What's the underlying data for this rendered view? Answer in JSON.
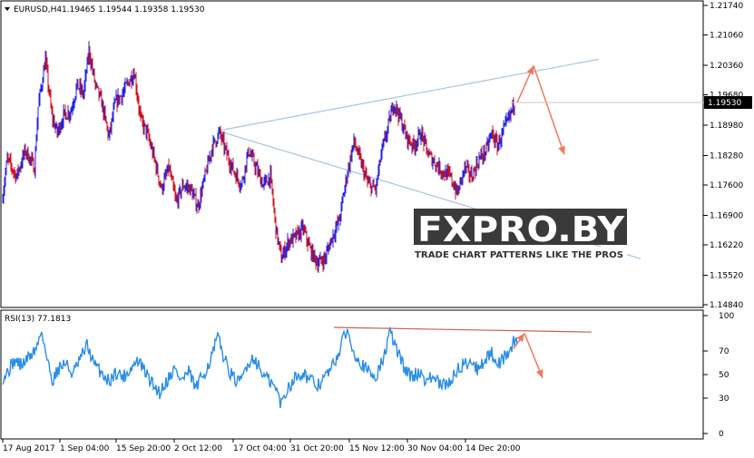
{
  "header": {
    "symbol": "EURUSD,H4",
    "ohlc": "1.19465 1.19544 1.19358 1.19530"
  },
  "current_price_label": "1.19530",
  "rsi_header": "RSI(13) 77.1813",
  "watermark": {
    "brand": "FXPRO.BY",
    "tagline": "TRADE CHART PATTERNS LIKE THE PROS"
  },
  "colors": {
    "bull": "#1e23e6",
    "bear": "#d0101e",
    "rsi": "#2a8ee6",
    "trendline": "#a8c4dc",
    "arrow": "#f07860",
    "rsi_resistance": "#c86050"
  },
  "chart_data": [
    {
      "type": "candlestick",
      "title": "EURUSD,H4",
      "y_ticks": [
        "1.21740",
        "1.21060",
        "1.20360",
        "1.19680",
        "1.18980",
        "1.18280",
        "1.17600",
        "1.16900",
        "1.16220",
        "1.15520",
        "1.14840"
      ],
      "ylim": [
        1.1484,
        1.2174
      ],
      "x_ticks": [
        "17 Aug 2017",
        "1 Sep 04:00",
        "15 Sep 20:00",
        "2 Oct 12:00",
        "17 Oct 04:00",
        "31 Oct 20:00",
        "15 Nov 12:00",
        "30 Nov 04:00",
        "14 Dec 20:00"
      ],
      "last_close": 1.1953,
      "path": [
        [
          0,
          1.169
        ],
        [
          8,
          1.182
        ],
        [
          18,
          1.178
        ],
        [
          28,
          1.184
        ],
        [
          38,
          1.18
        ],
        [
          42,
          1.194
        ],
        [
          50,
          1.205
        ],
        [
          57,
          1.192
        ],
        [
          63,
          1.188
        ],
        [
          70,
          1.192
        ],
        [
          78,
          1.193
        ],
        [
          85,
          1.199
        ],
        [
          92,
          1.197
        ],
        [
          98,
          1.207
        ],
        [
          105,
          1.199
        ],
        [
          112,
          1.195
        ],
        [
          120,
          1.187
        ],
        [
          127,
          1.195
        ],
        [
          135,
          1.197
        ],
        [
          142,
          1.2
        ],
        [
          148,
          1.202
        ],
        [
          155,
          1.191
        ],
        [
          162,
          1.188
        ],
        [
          170,
          1.182
        ],
        [
          178,
          1.175
        ],
        [
          186,
          1.18
        ],
        [
          194,
          1.172
        ],
        [
          202,
          1.176
        ],
        [
          210,
          1.175
        ],
        [
          218,
          1.171
        ],
        [
          226,
          1.178
        ],
        [
          234,
          1.185
        ],
        [
          242,
          1.188
        ],
        [
          250,
          1.183
        ],
        [
          258,
          1.179
        ],
        [
          266,
          1.176
        ],
        [
          274,
          1.184
        ],
        [
          282,
          1.18
        ],
        [
          290,
          1.176
        ],
        [
          298,
          1.178
        ],
        [
          304,
          1.166
        ],
        [
          310,
          1.159
        ],
        [
          318,
          1.163
        ],
        [
          326,
          1.164
        ],
        [
          334,
          1.166
        ],
        [
          342,
          1.161
        ],
        [
          350,
          1.158
        ],
        [
          358,
          1.159
        ],
        [
          366,
          1.164
        ],
        [
          374,
          1.168
        ],
        [
          382,
          1.178
        ],
        [
          390,
          1.186
        ],
        [
          398,
          1.181
        ],
        [
          406,
          1.176
        ],
        [
          414,
          1.175
        ],
        [
          420,
          1.183
        ],
        [
          426,
          1.188
        ],
        [
          434,
          1.195
        ],
        [
          440,
          1.192
        ],
        [
          448,
          1.187
        ],
        [
          456,
          1.185
        ],
        [
          464,
          1.188
        ],
        [
          472,
          1.183
        ],
        [
          480,
          1.181
        ],
        [
          488,
          1.179
        ],
        [
          496,
          1.178
        ],
        [
          504,
          1.174
        ],
        [
          512,
          1.18
        ],
        [
          520,
          1.178
        ],
        [
          528,
          1.182
        ],
        [
          536,
          1.184
        ],
        [
          542,
          1.188
        ],
        [
          548,
          1.185
        ],
        [
          556,
          1.189
        ],
        [
          562,
          1.192
        ],
        [
          567,
          1.1953
        ]
      ],
      "trendlines": [
        {
          "x1": 240,
          "y1": 1.1885,
          "x2": 660,
          "y2": 1.205
        },
        {
          "x1": 240,
          "y1": 1.1885,
          "x2": 706,
          "y2": 1.159
        }
      ],
      "arrows": [
        {
          "x1": 570,
          "y1": 1.195,
          "x2": 588,
          "y2": 1.2035
        },
        {
          "x1": 588,
          "y1": 1.2035,
          "x2": 622,
          "y2": 1.183
        }
      ]
    },
    {
      "type": "line",
      "title": "RSI(13) 77.1813",
      "y_ticks": [
        "100",
        "70",
        "50",
        "30",
        "0"
      ],
      "ylim": [
        0,
        100
      ],
      "last_value": 77.1813,
      "path": [
        [
          0,
          45
        ],
        [
          8,
          52
        ],
        [
          16,
          62
        ],
        [
          24,
          58
        ],
        [
          32,
          65
        ],
        [
          40,
          72
        ],
        [
          46,
          88
        ],
        [
          52,
          62
        ],
        [
          58,
          45
        ],
        [
          64,
          55
        ],
        [
          72,
          60
        ],
        [
          80,
          50
        ],
        [
          88,
          62
        ],
        [
          96,
          75
        ],
        [
          104,
          58
        ],
        [
          112,
          52
        ],
        [
          120,
          44
        ],
        [
          128,
          52
        ],
        [
          136,
          48
        ],
        [
          144,
          55
        ],
        [
          152,
          62
        ],
        [
          160,
          52
        ],
        [
          168,
          42
        ],
        [
          176,
          35
        ],
        [
          184,
          45
        ],
        [
          192,
          55
        ],
        [
          200,
          45
        ],
        [
          208,
          52
        ],
        [
          216,
          38
        ],
        [
          224,
          50
        ],
        [
          232,
          62
        ],
        [
          240,
          82
        ],
        [
          248,
          62
        ],
        [
          256,
          48
        ],
        [
          264,
          42
        ],
        [
          272,
          58
        ],
        [
          280,
          65
        ],
        [
          288,
          52
        ],
        [
          296,
          45
        ],
        [
          304,
          38
        ],
        [
          310,
          25
        ],
        [
          318,
          40
        ],
        [
          326,
          48
        ],
        [
          334,
          52
        ],
        [
          342,
          45
        ],
        [
          350,
          40
        ],
        [
          358,
          48
        ],
        [
          366,
          56
        ],
        [
          374,
          70
        ],
        [
          382,
          88
        ],
        [
          390,
          70
        ],
        [
          398,
          60
        ],
        [
          406,
          52
        ],
        [
          414,
          48
        ],
        [
          422,
          62
        ],
        [
          430,
          86
        ],
        [
          438,
          70
        ],
        [
          446,
          55
        ],
        [
          454,
          48
        ],
        [
          462,
          52
        ],
        [
          470,
          45
        ],
        [
          478,
          48
        ],
        [
          486,
          40
        ],
        [
          494,
          42
        ],
        [
          502,
          52
        ],
        [
          510,
          58
        ],
        [
          518,
          62
        ],
        [
          526,
          55
        ],
        [
          534,
          62
        ],
        [
          542,
          68
        ],
        [
          550,
          60
        ],
        [
          558,
          66
        ],
        [
          566,
          77
        ],
        [
          570,
          77.2
        ]
      ],
      "resistance": {
        "x1": 368,
        "y1": 90,
        "x2": 652,
        "y2": 86
      },
      "arrows": [
        {
          "x1": 566,
          "y1": 72,
          "x2": 578,
          "y2": 85
        },
        {
          "x1": 578,
          "y1": 85,
          "x2": 598,
          "y2": 47
        }
      ]
    }
  ]
}
